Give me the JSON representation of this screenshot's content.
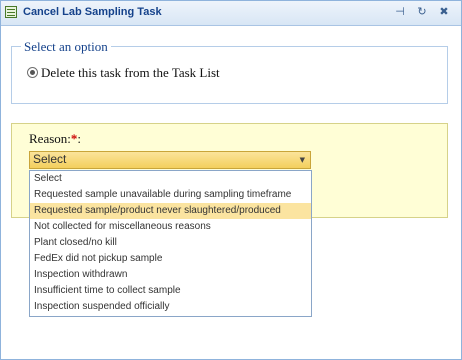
{
  "window": {
    "title": "Cancel Lab Sampling Task",
    "buttons": [
      {
        "name": "pin-icon",
        "glyph": "⊣"
      },
      {
        "name": "refresh-icon",
        "glyph": "↻"
      },
      {
        "name": "close-icon",
        "glyph": "✖"
      }
    ]
  },
  "options_section": {
    "legend": "Select an option",
    "radio_label": "Delete this task from the Task List",
    "radio_selected": true
  },
  "reason": {
    "label": "Reason:",
    "required_marker": "*",
    "colon": ":",
    "selected_value": "Select",
    "arrow_glyph": "▼",
    "options": [
      "Select",
      "Requested sample unavailable during sampling timeframe",
      "Requested sample/product never slaughtered/produced",
      "Not collected for miscellaneous reasons",
      "Plant closed/no kill",
      "FedEx did not pickup sample",
      "Inspection withdrawn",
      "Insufficient time to collect sample",
      "Inspection suspended officially"
    ],
    "highlighted_option": "Requested sample/product never slaughtered/produced"
  },
  "colors": {
    "title_text": "#15428b",
    "highlight": "#fbe4a0",
    "reason_panel": "#fffed6",
    "required": "#cc0000"
  }
}
